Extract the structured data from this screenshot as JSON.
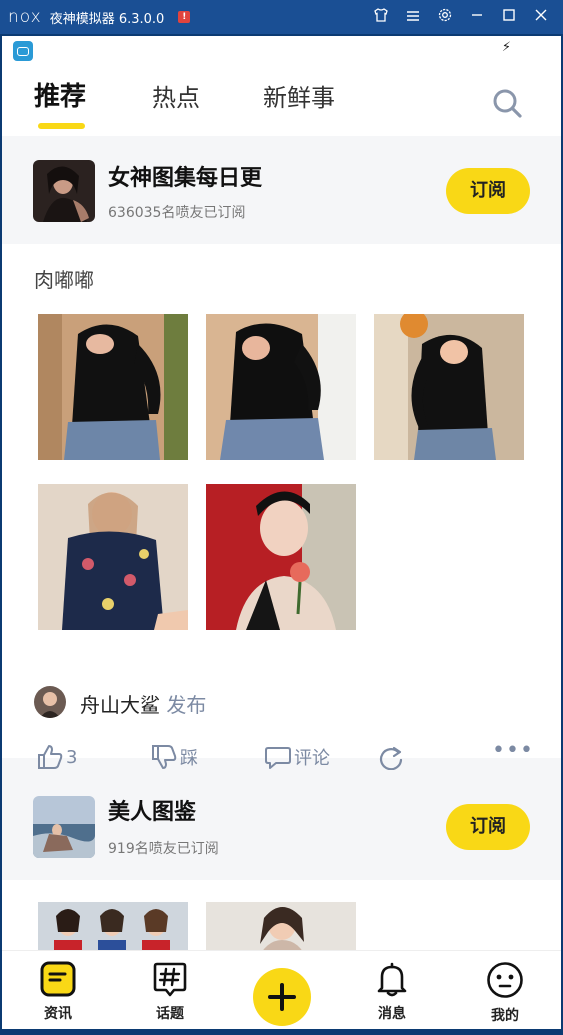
{
  "emulator": {
    "logo": "nox",
    "title": "夜神模拟器 6.3.0.0",
    "badge": "!"
  },
  "tabs": [
    {
      "label": "推荐",
      "active": true
    },
    {
      "label": "热点",
      "active": false
    },
    {
      "label": "新鲜事",
      "active": false
    }
  ],
  "feed": [
    {
      "channel": {
        "title": "女神图集每日更",
        "subscribers": "636035名喷友已订阅",
        "subscribe_label": "订阅"
      },
      "post": {
        "title": "肉嘟嘟",
        "author": "舟山大鲨",
        "author_action": "发布",
        "actions": {
          "like_count": "3",
          "dislike_label": "踩",
          "comment_label": "评论"
        }
      }
    },
    {
      "channel": {
        "title": "美人图鉴",
        "subscribers": "919名喷友已订阅",
        "subscribe_label": "订阅"
      }
    }
  ],
  "bottom_nav": [
    {
      "label": "资讯",
      "icon": "news-icon",
      "active": true
    },
    {
      "label": "话题",
      "icon": "hashtag-icon",
      "active": false
    },
    {
      "label": "",
      "icon": "plus-icon",
      "active": false
    },
    {
      "label": "消息",
      "icon": "bell-icon",
      "active": false
    },
    {
      "label": "我的",
      "icon": "face-icon",
      "active": false
    }
  ],
  "colors": {
    "accent": "#f9d816",
    "muted": "#7c8aa3",
    "titlebar": "#1a4f94"
  }
}
